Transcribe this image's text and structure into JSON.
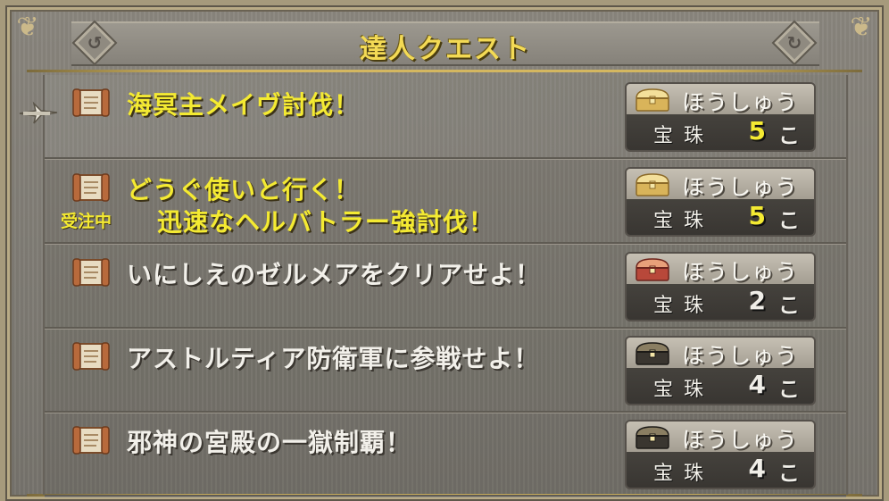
{
  "title": "達人クエスト",
  "accepted_label": "受注中",
  "reward_label": "ほうしゅう",
  "reward_item": "宝珠",
  "reward_unit": "こ",
  "colors": {
    "highlight_text": "#f4ea32",
    "normal_text": "#f2f0ea",
    "title_gold": "#f3da55",
    "chest_gold": "#d9b45a",
    "chest_red": "#b8483a",
    "chest_black": "#3a3630"
  },
  "quests": [
    {
      "names": [
        "海冥主メイヴ討伐！"
      ],
      "style": "yellow",
      "accepted": false,
      "chest": "gold",
      "reward_qty": "5"
    },
    {
      "names": [
        "どうぐ使いと行く！",
        "迅速なヘルバトラー強討伐！"
      ],
      "style": "yellow",
      "accepted": true,
      "chest": "gold",
      "reward_qty": "5"
    },
    {
      "names": [
        "いにしえのゼルメアをクリアせよ！"
      ],
      "style": "white",
      "accepted": false,
      "chest": "red",
      "reward_qty": "2"
    },
    {
      "names": [
        "アストルティア防衛軍に参戦せよ！"
      ],
      "style": "white",
      "accepted": false,
      "chest": "black",
      "reward_qty": "4"
    },
    {
      "names": [
        "邪神の宮殿の一獄制覇！"
      ],
      "style": "white",
      "accepted": false,
      "chest": "black",
      "reward_qty": "4"
    }
  ]
}
